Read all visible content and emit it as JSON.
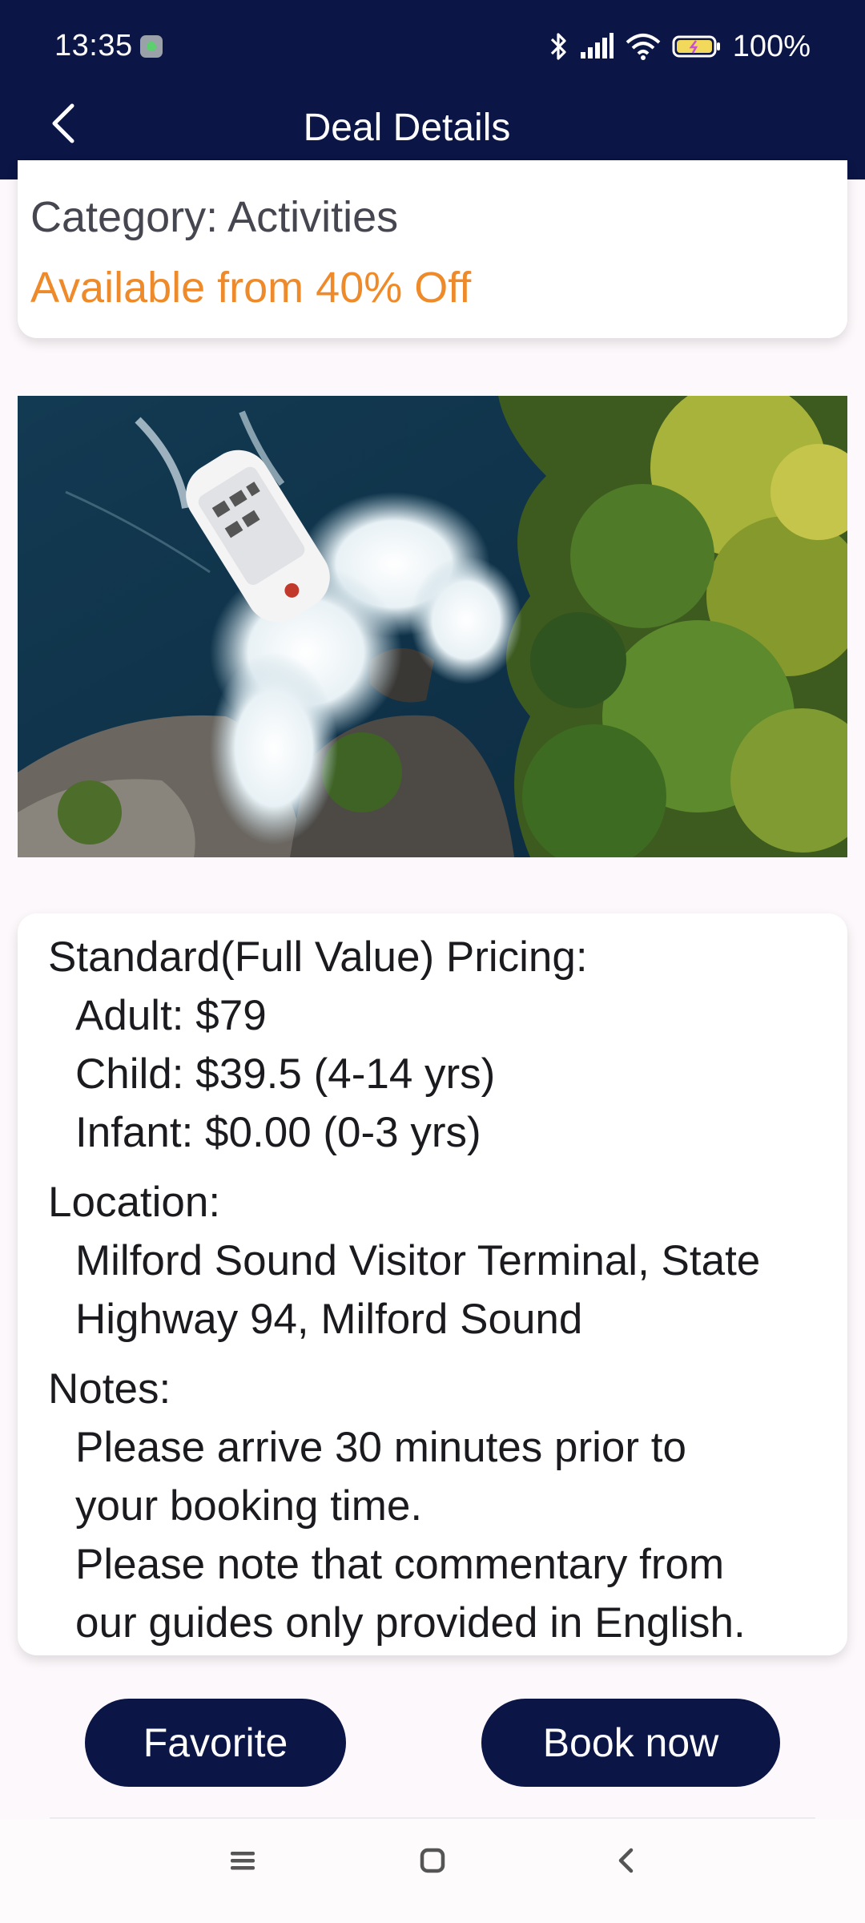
{
  "status_bar": {
    "time": "13:35",
    "battery": "100%"
  },
  "app_bar": {
    "title": "Deal Details",
    "back_icon": "chevron-left-icon"
  },
  "summary": {
    "category": "Category: Activities",
    "discount": "Available from 40% Off"
  },
  "info": {
    "pricing_heading": "Standard(Full Value) Pricing:",
    "adult": "Adult: $79",
    "child": "Child: $39.5 (4-14 yrs)",
    "infant": "Infant: $0.00 (0-3 yrs)",
    "location_heading": "Location:",
    "location_line1": "Milford Sound Visitor Terminal, State",
    "location_line2": "Highway 94, Milford Sound",
    "notes_heading": "Notes:",
    "note_line1": "Please arrive 30 minutes prior to",
    "note_line2": "your booking time.",
    "note_line3": "Please note that commentary from",
    "note_line4": "our guides only provided in English."
  },
  "actions": {
    "favorite_label": "Favorite",
    "book_label": "Book now"
  },
  "colors": {
    "primary": "#0b1546",
    "accent": "#ef8a2a",
    "background": "#fcf8fb"
  }
}
